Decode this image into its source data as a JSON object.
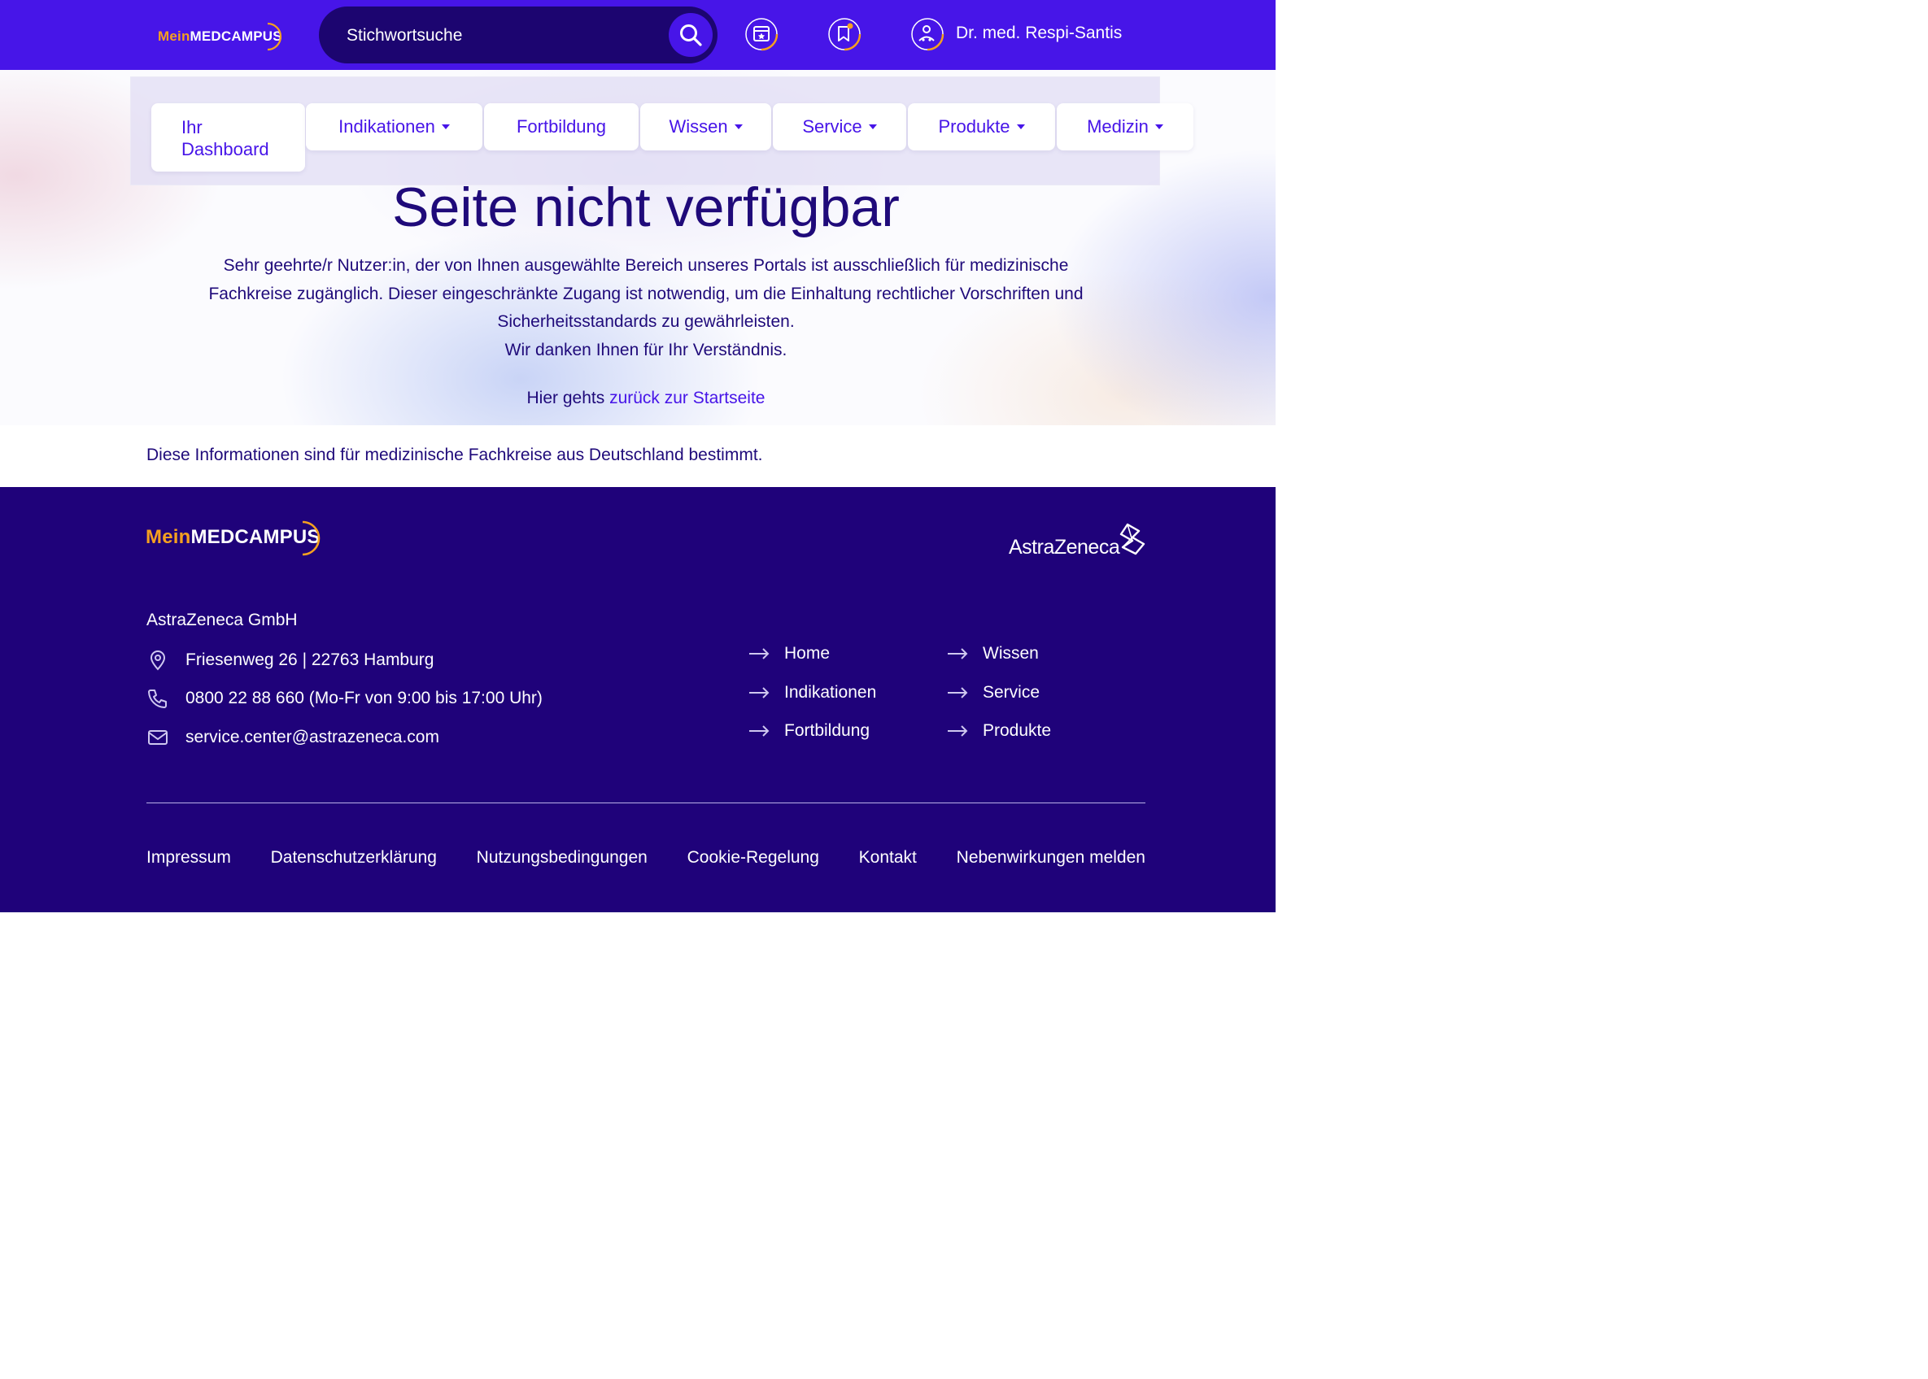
{
  "header": {
    "logo": {
      "mein": "Mein",
      "med": "MEDCAMPUS"
    },
    "search_placeholder": "Stichwortsuche",
    "icons": [
      "search-icon",
      "calendar-star-icon",
      "bookmark-icon",
      "user-icon"
    ],
    "user_name": "Dr. med. Respi-Santis"
  },
  "nav": {
    "items": [
      {
        "label": "Ihr Dashboard",
        "dropdown": false,
        "active": true
      },
      {
        "label": "Indikationen",
        "dropdown": true
      },
      {
        "label": "Fortbildung",
        "dropdown": false
      },
      {
        "label": "Wissen",
        "dropdown": true
      },
      {
        "label": "Service",
        "dropdown": true
      },
      {
        "label": "Produkte",
        "dropdown": true
      },
      {
        "label": "Medizin",
        "dropdown": true
      }
    ]
  },
  "main": {
    "title": "Seite nicht verfügbar",
    "message_lines": [
      "Sehr geehrte/r Nutzer:in, der von Ihnen ausgewählte Bereich unseres Portals ist ausschließlich für medizinische",
      "Fachkreise zugänglich. Dieser eingeschränkte Zugang ist notwendig, um die Einhaltung rechtlicher Vorschriften und",
      "Sicherheitsstandards zu gewährleisten.",
      "Wir danken Ihnen für Ihr Verständnis."
    ],
    "back_prefix": "Hier gehts ",
    "back_link": "zurück zur Startseite"
  },
  "disclaimer": "Diese Informationen sind für medizinische Fachkreise aus Deutschland bestimmt.",
  "footer": {
    "logo": {
      "mein": "Mein",
      "med": "MEDCAMPUS"
    },
    "partner_logo": "AstraZeneca",
    "company": "AstraZeneca GmbH",
    "address": "Friesenweg 26 | 22763 Hamburg",
    "phone": "0800 22 88 660 (Mo-Fr von 9:00 bis 17:00 Uhr)",
    "email": "service.center@astrazeneca.com",
    "links_col1": [
      "Home",
      "Indikationen",
      "Fortbildung"
    ],
    "links_col2": [
      "Wissen",
      "Service",
      "Produkte"
    ],
    "bottom_links": [
      "Impressum",
      "Datenschutzerklärung",
      "Nutzungsbedingungen",
      "Cookie-Regelung",
      "Kontakt",
      "Nebenwirkungen melden"
    ]
  },
  "colors": {
    "primary": "#4715e8",
    "dark": "#1f027a",
    "accent": "#f5a020"
  }
}
